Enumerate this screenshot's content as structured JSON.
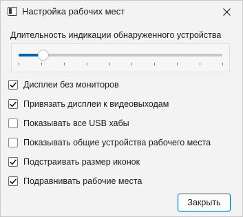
{
  "window": {
    "title": "Настройка рабочих мест",
    "icon": "window-icon",
    "close_icon": "close-icon"
  },
  "slider": {
    "label": "Длительность индикации обнаруженного устройства",
    "value_fraction": 0.12,
    "tick_count": 10,
    "accent_color": "#005fb8"
  },
  "options": [
    {
      "label": "Дисплеи без мониторов",
      "checked": true
    },
    {
      "label": "Привязать дисплеи к видеовыходам",
      "checked": true
    },
    {
      "label": "Показывать все USB хабы",
      "checked": false
    },
    {
      "label": "Показывать общие устройства рабочего места",
      "checked": false
    },
    {
      "label": "Подстраивать размер иконок",
      "checked": true
    },
    {
      "label": "Подравнивать рабочие места",
      "checked": true
    }
  ],
  "buttons": {
    "close_label": "Закрыть"
  }
}
